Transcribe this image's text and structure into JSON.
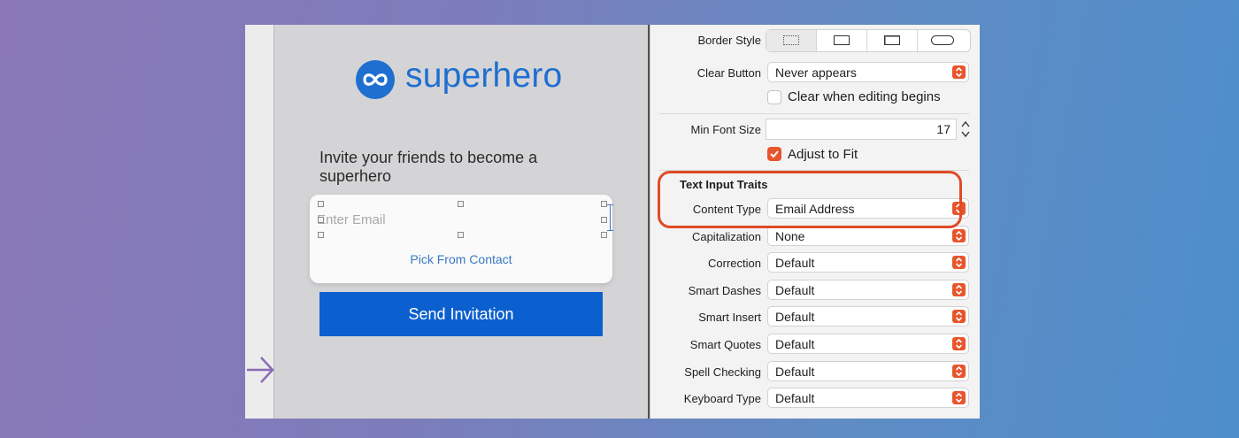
{
  "canvas": {
    "logo_text": "superhero",
    "invite_text": "Invite your friends to become a superhero",
    "email_placeholder": "Enter Email",
    "pick_label": "Pick From Contact",
    "send_label": "Send Invitation"
  },
  "inspector": {
    "border_style": {
      "label": "Border Style",
      "options": [
        "none",
        "line",
        "bezel",
        "rounded"
      ],
      "selected": "none"
    },
    "clear_button": {
      "label": "Clear Button",
      "value": "Never appears"
    },
    "clear_editing": {
      "label": "Clear when editing begins",
      "checked": false
    },
    "min_font_size": {
      "label": "Min Font Size",
      "value": "17"
    },
    "adjust_to_fit": {
      "label": "Adjust to Fit",
      "checked": true
    },
    "section_title": "Text Input Traits",
    "content_type": {
      "label": "Content Type",
      "value": "Email Address"
    },
    "capitalization": {
      "label": "Capitalization",
      "value": "None"
    },
    "correction": {
      "label": "Correction",
      "value": "Default"
    },
    "smart_dashes": {
      "label": "Smart Dashes",
      "value": "Default"
    },
    "smart_insert": {
      "label": "Smart Insert",
      "value": "Default"
    },
    "smart_quotes": {
      "label": "Smart Quotes",
      "value": "Default"
    },
    "spell_checking": {
      "label": "Spell Checking",
      "value": "Default"
    },
    "keyboard_type": {
      "label": "Keyboard Type",
      "value": "Default"
    }
  },
  "colors": {
    "brand_blue": "#1f6fd1",
    "accent_orange": "#e8542b",
    "highlight_red": "#e04a26"
  }
}
